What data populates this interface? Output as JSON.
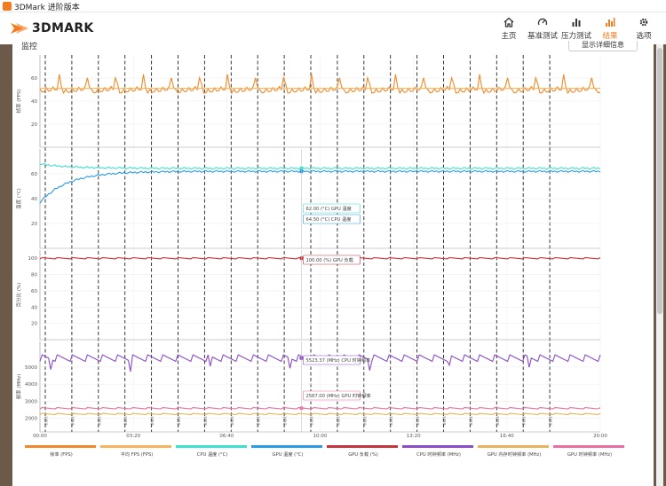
{
  "window": {
    "title": "3DMark 进阶版本"
  },
  "app": {
    "logo_text": "3DMARK"
  },
  "nav": [
    {
      "label": "主页",
      "icon": "home-icon"
    },
    {
      "label": "基准测试",
      "icon": "gauge-icon"
    },
    {
      "label": "压力测试",
      "icon": "bar-chart-icon"
    },
    {
      "label": "结果",
      "icon": "results-icon",
      "active": true
    },
    {
      "label": "选项",
      "icon": "gear-icon"
    }
  ],
  "section_title": "监控",
  "details_button": "显示详细信息",
  "colors": {
    "orange": "#f0892a",
    "orange_light": "#f7b35a",
    "cyan": "#3ee0d0",
    "blue": "#2b9be8",
    "red": "#c8343d",
    "purple": "#8a4cc8",
    "gold": "#e8b35a",
    "pink": "#e86ea3",
    "accent": "#f47c20"
  },
  "chart_data": {
    "type": "line",
    "x_ticks": [
      "00:00",
      "03:20",
      "06:40",
      "10:00",
      "13:20",
      "16:40",
      "20:00"
    ],
    "x_range": [
      0,
      1200
    ],
    "panels": [
      {
        "ylabel": "帧率 (FPS)",
        "y_ticks": [
          "20",
          "40",
          "60"
        ],
        "ylim": [
          0,
          80
        ],
        "series": [
          {
            "name": "帧率 (FPS)",
            "color": "#f0892a",
            "pattern": "sawtooth",
            "low": 45,
            "high": 64
          },
          {
            "name": "平均 FPS (FPS)",
            "color": "#f7b35a",
            "constant": 51
          }
        ]
      },
      {
        "ylabel": "温度 (°C)",
        "y_ticks": [
          "20",
          "40",
          "60"
        ],
        "ylim": [
          0,
          80
        ],
        "series": [
          {
            "name": "CPU 温度 (°C)",
            "color": "#3ee0d0",
            "start": 68,
            "value": 64.5
          },
          {
            "name": "GPU 温度 (°C)",
            "color": "#2b9be8",
            "start": 37,
            "value": 62.0
          }
        ],
        "tooltips": [
          "62.00 (°C) GPU 温度",
          "64.50 (°C) CPU 温度"
        ]
      },
      {
        "ylabel": "百分比 (%)",
        "y_ticks": [
          "20",
          "40",
          "60",
          "80",
          "100"
        ],
        "ylim": [
          0,
          110
        ],
        "series": [
          {
            "name": "GPU 负载 (%)",
            "color": "#c8343d",
            "value": 100.0
          }
        ],
        "tooltips": [
          "100.00 (%) GPU 负载"
        ]
      },
      {
        "ylabel": "频率 (MHz)",
        "y_ticks": [
          "2000",
          "3000",
          "4000",
          "5000"
        ],
        "ylim": [
          1200,
          6500
        ],
        "series": [
          {
            "name": "CPU 时钟频率 (MHz)",
            "color": "#8a4cc8",
            "value": 5523.37
          },
          {
            "name": "GPU 时钟频率 (MHz)",
            "color": "#e86ea3",
            "value": 2587.0
          },
          {
            "name": "GPU 内存时钟频率 (MHz)",
            "color": "#e8b35a",
            "value": 2250
          }
        ],
        "tooltips": [
          "5523.37 (MHz) CPU 时钟频率",
          "2587.00 (MHz) GPU 时钟频率"
        ]
      }
    ],
    "legend": [
      {
        "label": "帧率 (FPS)",
        "color": "#f0892a"
      },
      {
        "label": "平均 FPS (FPS)",
        "color": "#f7b35a"
      },
      {
        "label": "CPU 温度 (°C)",
        "color": "#3ee0d0"
      },
      {
        "label": "GPU 温度 (°C)",
        "color": "#2b9be8"
      },
      {
        "label": "GPU 负载 (%)",
        "color": "#c8343d"
      },
      {
        "label": "CPU 时钟频率 (MHz)",
        "color": "#8a4cc8"
      },
      {
        "label": "GPU 内存时钟频率 (MHz)",
        "color": "#e8b35a"
      },
      {
        "label": "GPU 时钟频率 (MHz)",
        "color": "#e86ea3"
      }
    ],
    "markers": {
      "count": 20,
      "label": "总帧数 1"
    },
    "cursor_x": 560
  }
}
